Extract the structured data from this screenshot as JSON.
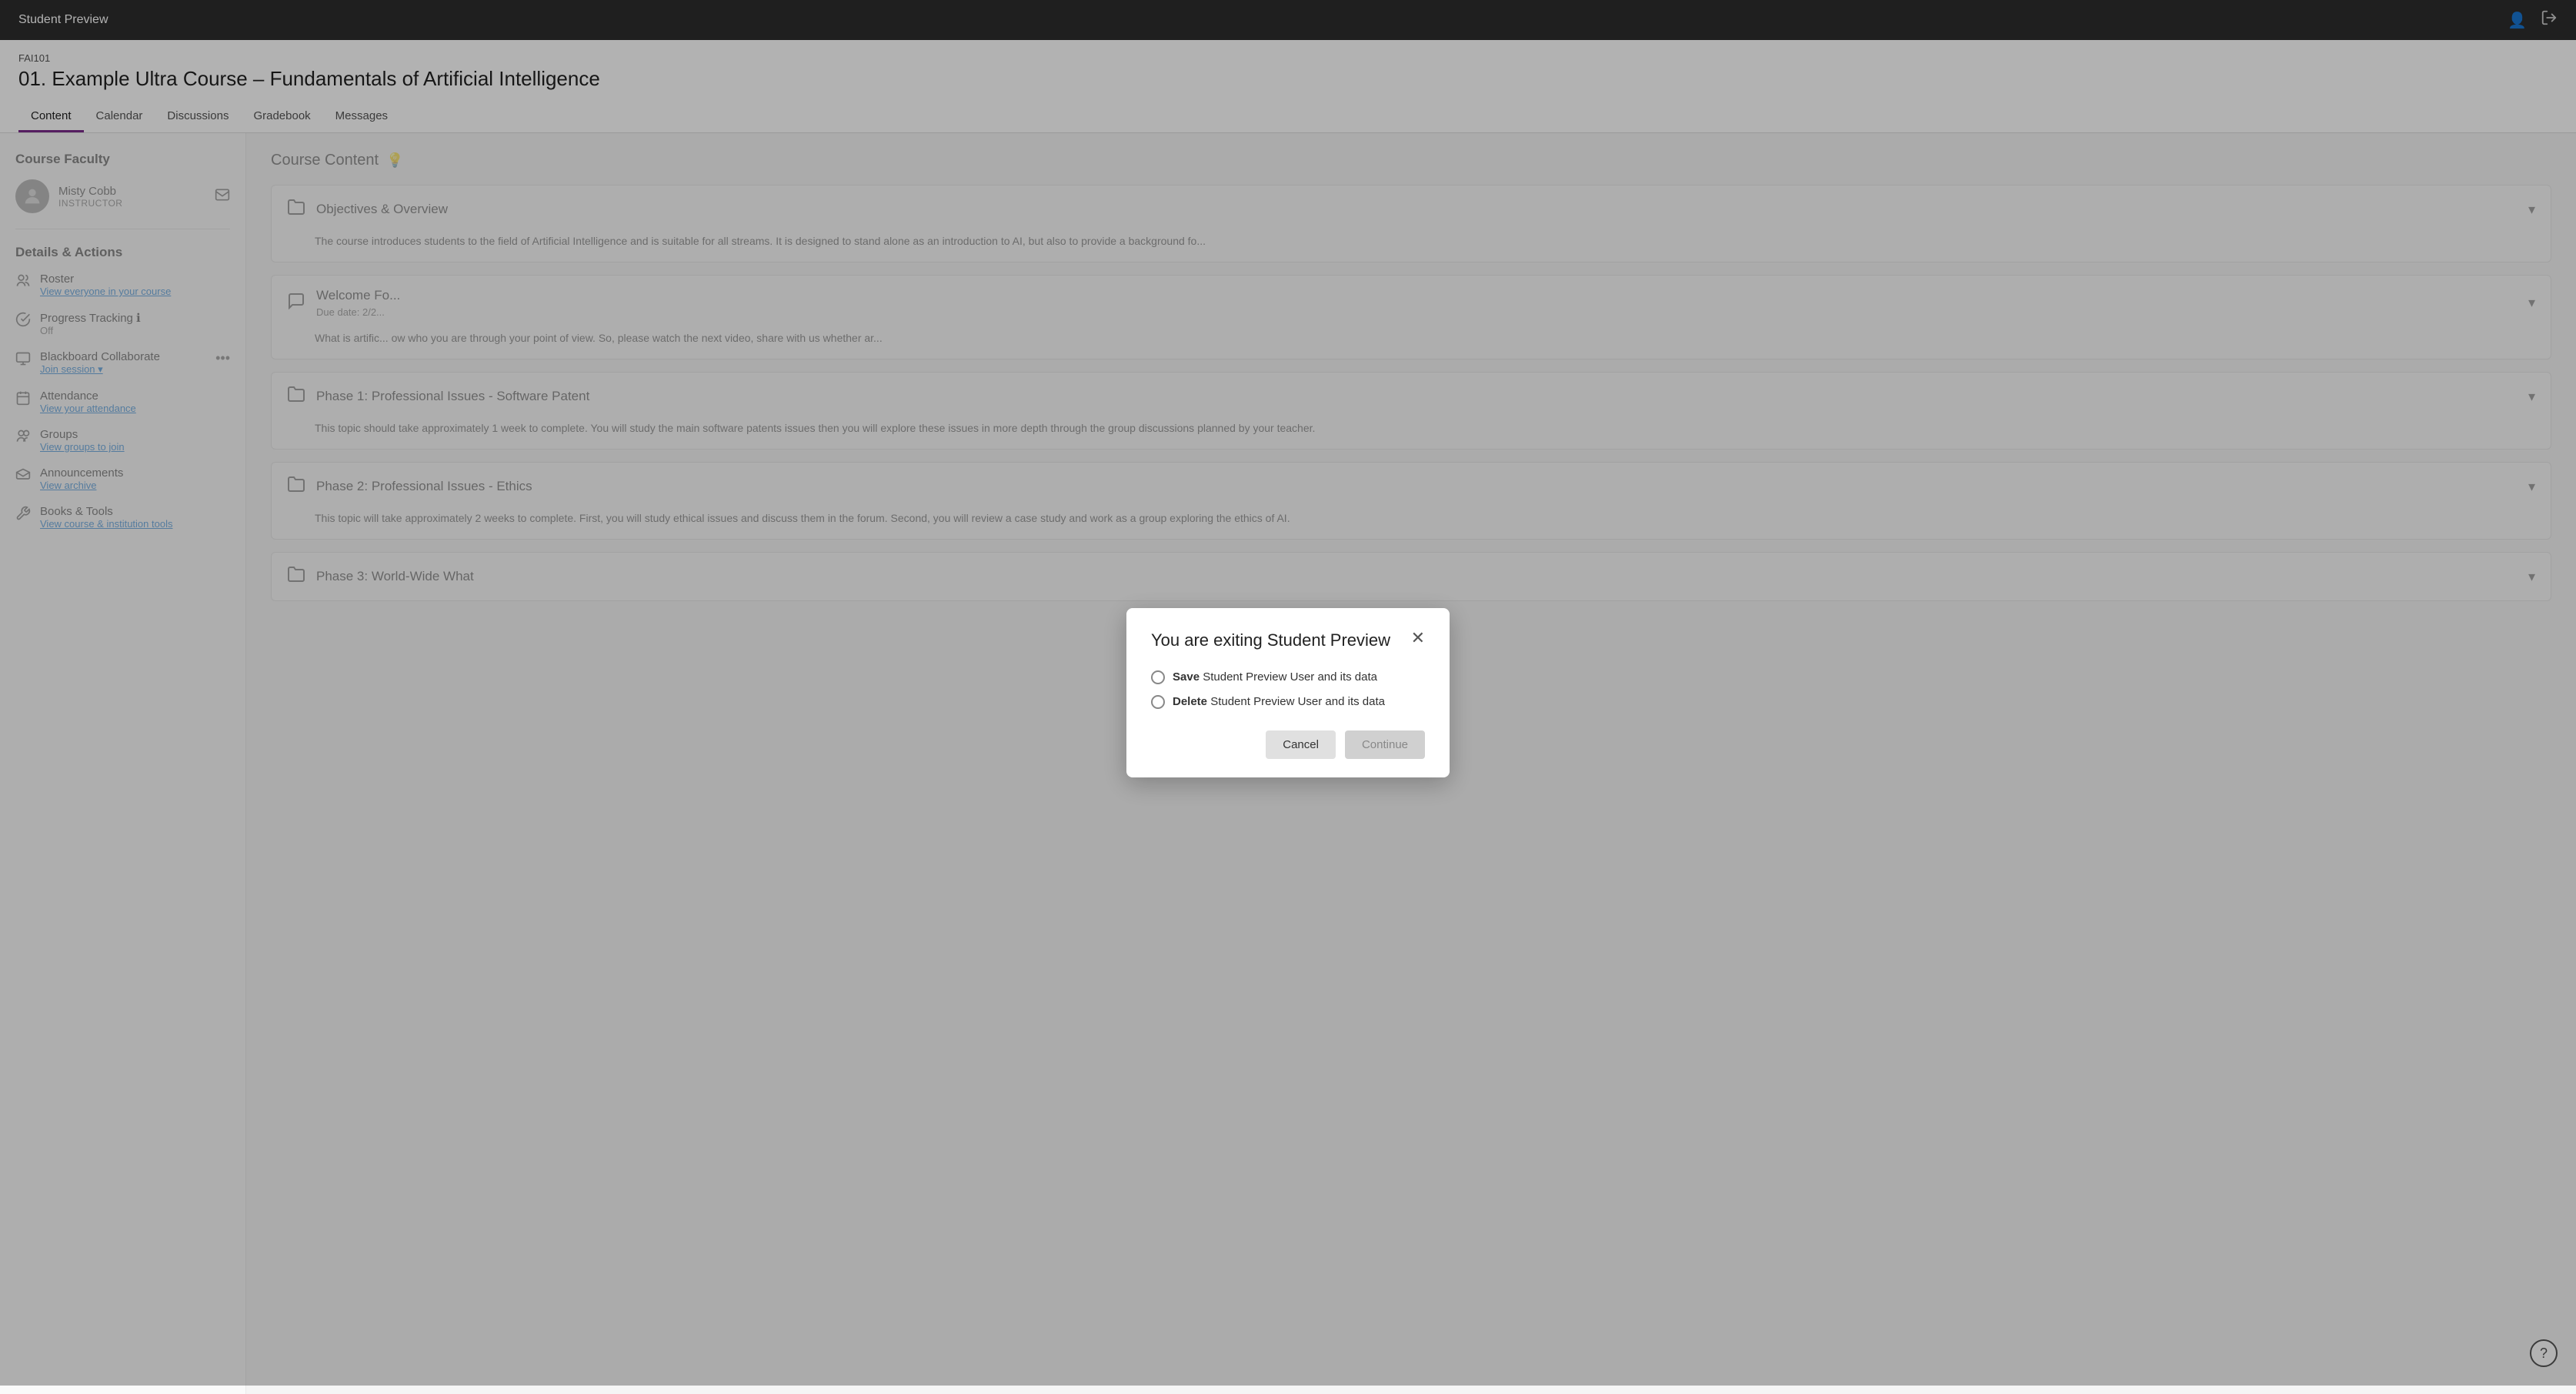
{
  "topbar": {
    "title": "Student Preview",
    "profile_icon": "👤",
    "exit_icon": "⎋"
  },
  "course": {
    "code": "FAI101",
    "title": "01. Example Ultra Course – Fundamentals of Artificial Intelligence"
  },
  "tabs": [
    {
      "label": "Content",
      "active": true
    },
    {
      "label": "Calendar",
      "active": false
    },
    {
      "label": "Discussions",
      "active": false
    },
    {
      "label": "Gradebook",
      "active": false
    },
    {
      "label": "Messages",
      "active": false
    }
  ],
  "sidebar": {
    "faculty_section": "Course Faculty",
    "faculty": {
      "name": "Misty Cobb",
      "role": "INSTRUCTOR",
      "avatar": "👤"
    },
    "details_section": "Details & Actions",
    "items": [
      {
        "icon": "👥",
        "title": "Roster",
        "link": "View everyone in your course"
      },
      {
        "icon": "✅",
        "title": "Progress Tracking ℹ",
        "value": "Off"
      },
      {
        "icon": "🎥",
        "title": "Blackboard Collaborate",
        "link": "Join session ▾",
        "more": true
      },
      {
        "icon": "📋",
        "title": "Attendance",
        "link": "View your attendance"
      },
      {
        "icon": "👫",
        "title": "Groups",
        "link": "View groups to join"
      },
      {
        "icon": "📢",
        "title": "Announcements",
        "link": "View archive"
      },
      {
        "icon": "🔧",
        "title": "Books & Tools",
        "link": "View course & institution tools"
      }
    ]
  },
  "content": {
    "header_title": "Course Content",
    "header_icon": "💡",
    "items": [
      {
        "icon": "📁",
        "title": "Objectives & Overview",
        "body": "The course introduces students to the field of Artificial Intelligence and is suitable for all streams. It is designed to stand alone as an introduction to AI, but also to provide a background fo..."
      },
      {
        "icon": "💬",
        "title": "Welcome Fo...",
        "sub": "Due date: 2/2...",
        "body": "What is artific... ow who you are through your point of view. So, please watch the next video, share with us whether ar..."
      },
      {
        "icon": "📁",
        "title": "Phase 1: Professional Issues - Software Patent",
        "body": "This topic should take approximately 1 week to complete. You will study the main software patents issues then you will explore these issues in more depth through the group discussions planned by your teacher."
      },
      {
        "icon": "📁",
        "title": "Phase 2: Professional Issues - Ethics",
        "body": "This topic will take approximately 2 weeks to complete. First, you will study ethical issues and discuss them in the forum. Second, you will review a case study and work as a group exploring the ethics of AI."
      },
      {
        "icon": "📁",
        "title": "Phase 3: World-Wide What",
        "body": ""
      }
    ]
  },
  "dialog": {
    "title": "You are exiting Student Preview",
    "options": [
      {
        "id": "save",
        "label_bold": "Save",
        "label_rest": " Student Preview User and its data"
      },
      {
        "id": "delete",
        "label_bold": "Delete",
        "label_rest": " Student Preview User and its data"
      }
    ],
    "cancel_label": "Cancel",
    "continue_label": "Continue"
  },
  "help_icon": "?"
}
